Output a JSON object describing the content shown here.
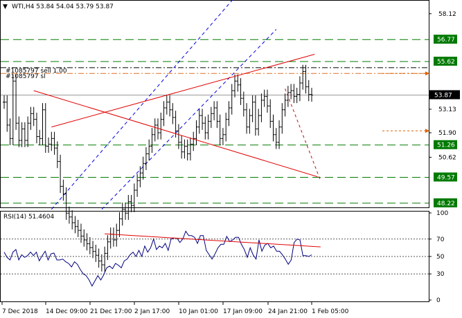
{
  "title": {
    "marker": "▼",
    "text": "WTI,H4  53.84 54.04 53.79 53.87"
  },
  "order_label_1": "#1085797 sell 1.00",
  "order_label_2": "#1085797 sl",
  "chart_data": {
    "type": "candlestick",
    "symbol": "WTI",
    "timeframe": "H4",
    "ohlc_last": {
      "open": 53.84,
      "high": 54.04,
      "low": 53.79,
      "close": 53.87
    },
    "current_price": 53.87,
    "price_axis": {
      "ylim": [
        48.0,
        58.8
      ],
      "ticks": [
        58.12,
        53.13,
        51.9,
        50.62
      ]
    },
    "levels": [
      {
        "value": 56.77,
        "label": "56.77",
        "color": "#007a00",
        "style": "dashed"
      },
      {
        "value": 55.62,
        "label": "55.62",
        "color": "#007a00",
        "style": "dashed"
      },
      {
        "value": 51.26,
        "label": "51.26",
        "color": "#007a00",
        "style": "dashed"
      },
      {
        "value": 49.57,
        "label": "49.57",
        "color": "#007a00",
        "style": "dashed"
      },
      {
        "value": 48.22,
        "label": "48.22",
        "color": "#007a00",
        "style": "dashed"
      }
    ],
    "order_lines": [
      {
        "value": 55.3,
        "color": "#000000",
        "style": "dash-dot"
      },
      {
        "value": 55.0,
        "color": "#e07020",
        "style": "dash-dot"
      }
    ],
    "x_labels": [
      "7 Dec 2018",
      "14 Dec 09:00",
      "21 Dec 17:00",
      "2 Jan 17:00",
      "10 Jan 01:00",
      "17 Jan 09:00",
      "24 Jan 21:00",
      "1 Feb 05:00"
    ],
    "price_series": [
      53.5,
      52.3,
      51.6,
      54.6,
      52.4,
      51.5,
      52.1,
      51.5,
      52.4,
      52.9,
      52.6,
      51.7,
      51.6,
      53.1,
      51.2,
      51.3,
      51.6,
      51.1,
      50.4,
      49.1,
      48.7,
      47.7,
      47.5,
      47.2,
      47.0,
      46.8,
      46.5,
      46.3,
      46.1,
      45.9,
      45.7,
      45.5,
      45.2,
      45.0,
      45.6,
      46.2,
      46.6,
      46.3,
      46.8,
      47.4,
      47.9,
      47.7,
      48.3,
      48.1,
      48.9,
      49.4,
      49.8,
      50.3,
      50.8,
      51.2,
      51.8,
      52.3,
      51.9,
      52.6,
      53.2,
      53.5,
      53.1,
      52.7,
      52.0,
      51.4,
      50.9,
      51.2,
      50.8,
      51.3,
      51.6,
      52.2,
      52.8,
      52.4,
      51.9,
      52.5,
      52.9,
      53.2,
      52.5,
      51.6,
      51.8,
      52.6,
      53.2,
      54.1,
      54.6,
      54.4,
      53.7,
      53.1,
      52.2,
      52.8,
      53.5,
      52.1,
      52.8,
      53.6,
      53.8,
      53.3,
      52.5,
      51.8,
      51.4,
      52.2,
      53.1,
      53.6,
      54.0,
      54.1,
      53.8,
      53.9,
      54.5,
      55.1,
      54.3,
      53.9,
      53.87
    ],
    "indicator": {
      "name": "RSI",
      "label": "RSI(14) 51.4604",
      "period": 14,
      "value": 51.4604,
      "ylim": [
        0,
        100
      ],
      "ticks": [
        100,
        70,
        50,
        30,
        0
      ],
      "levels": [
        70,
        50,
        30
      ],
      "values": [
        55,
        49,
        46,
        55,
        58,
        46,
        52,
        49,
        51,
        55,
        51,
        55,
        45,
        51,
        56,
        46,
        53,
        54,
        46,
        46,
        47,
        44,
        42,
        38,
        44,
        41,
        35,
        30,
        28,
        23,
        16,
        22,
        28,
        23,
        29,
        37,
        39,
        36,
        42,
        40,
        37,
        45,
        47,
        52,
        55,
        50,
        57,
        50,
        62,
        55,
        60,
        70,
        58,
        62,
        60,
        65,
        57,
        70,
        71,
        71,
        66,
        70,
        79,
        74,
        74,
        72,
        65,
        74,
        74,
        57,
        52,
        47,
        53,
        60,
        64,
        64,
        73,
        67,
        69,
        72,
        72,
        64,
        58,
        49,
        60,
        52,
        47,
        69,
        56,
        63,
        65,
        60,
        62,
        56,
        56,
        52,
        47,
        41,
        46,
        66,
        70,
        69,
        51,
        51,
        50,
        52
      ]
    },
    "annotations": [
      {
        "type": "trendline",
        "color": "#e00000",
        "from": [
          16,
          52.2
        ],
        "to": [
          105,
          56.0
        ]
      },
      {
        "type": "trendline",
        "color": "#e00000",
        "from": [
          10,
          54.1
        ],
        "to": [
          106,
          49.6
        ]
      },
      {
        "type": "trendline",
        "color": "#0000e0",
        "style": "dashed",
        "from": [
          16,
          47.9
        ],
        "to": [
          82,
          59.7
        ]
      },
      {
        "type": "trendline",
        "color": "#0000e0",
        "style": "dashed",
        "from": [
          33,
          47.9
        ],
        "to": [
          92,
          57.3
        ]
      },
      {
        "type": "trendline",
        "color": "#e00000",
        "style": "dashed",
        "from": [
          95,
          54.2
        ],
        "to": [
          107,
          49.4
        ]
      },
      {
        "type": "rsi_trendline",
        "color": "#e00000",
        "from": [
          34,
          76
        ],
        "to": [
          107,
          61
        ]
      }
    ]
  }
}
